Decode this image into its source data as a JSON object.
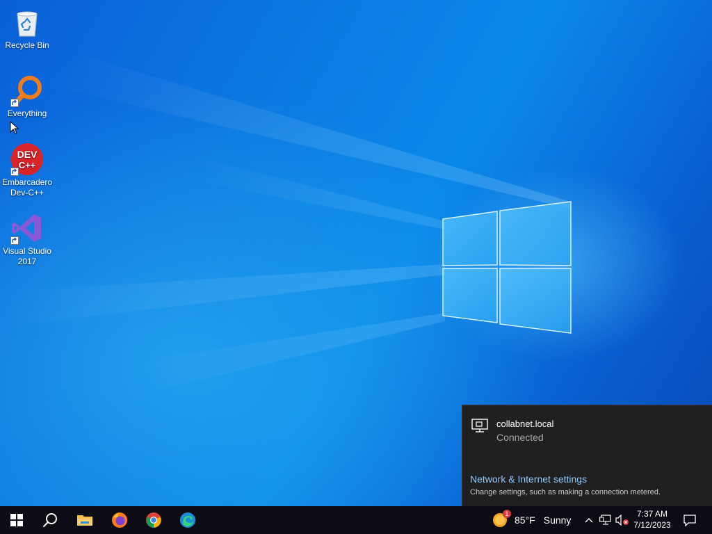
{
  "desktop": {
    "icons": [
      {
        "label": "Recycle Bin",
        "icon": "recycle-bin-icon"
      },
      {
        "label": "Everything",
        "icon": "everything-search-icon"
      },
      {
        "label": "Embarcadero Dev-C++",
        "icon": "dev-cpp-icon",
        "icon_text_top": "DEV",
        "icon_text_bottom": "C++"
      },
      {
        "label": "Visual Studio 2017",
        "icon": "visual-studio-icon"
      }
    ]
  },
  "network_flyout": {
    "network_name": "collabnet.local",
    "status": "Connected",
    "settings_link": "Network & Internet settings",
    "settings_description": "Change settings, such as making a connection metered."
  },
  "taskbar": {
    "pinned_apps": [
      {
        "name": "start-button",
        "icon": "windows-logo-icon"
      },
      {
        "name": "search-button",
        "icon": "search-icon"
      },
      {
        "name": "file-explorer",
        "icon": "folder-icon"
      },
      {
        "name": "firefox",
        "icon": "firefox-icon"
      },
      {
        "name": "chrome",
        "icon": "chrome-icon"
      },
      {
        "name": "edge",
        "icon": "edge-icon"
      }
    ],
    "weather": {
      "temperature": "85°F",
      "condition": "Sunny",
      "badge": "1",
      "icon": "sun-weather-icon"
    },
    "tray": {
      "icons": [
        "chevron-up-icon",
        "network-icon",
        "volume-muted-icon"
      ]
    },
    "clock": {
      "time": "7:37 AM",
      "date": "7/12/2023"
    }
  },
  "colors": {
    "taskbar": "#0c0c14",
    "flyout_bg": "#202020",
    "link": "#8ec8ff",
    "wallpaper_blue": "#0a78e0"
  }
}
